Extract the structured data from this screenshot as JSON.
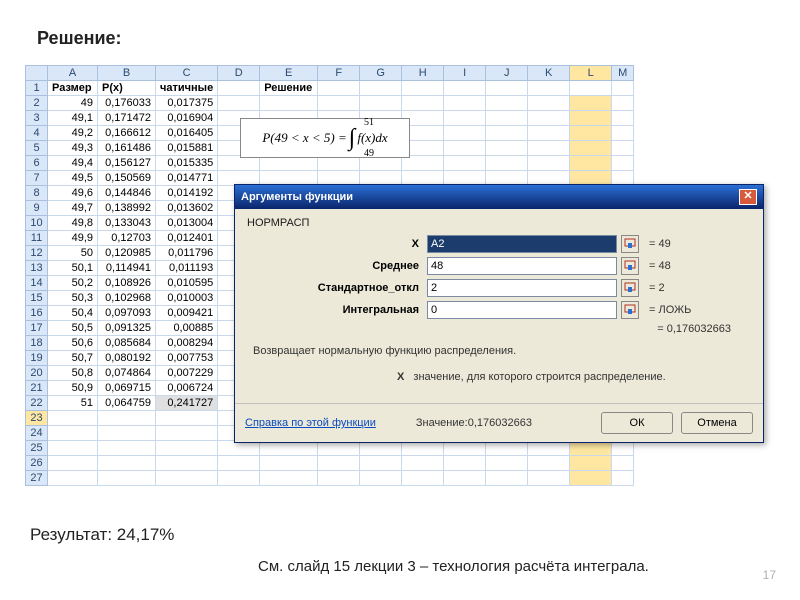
{
  "page": {
    "title": "Решение:",
    "result": "Результат: 24,17%",
    "footnote": "См. слайд 15 лекции 3 – технология расчёта интеграла.",
    "pagenum": "17"
  },
  "formula": {
    "text": "P(49 < x < 5) =",
    "upper": "51",
    "lower": "49",
    "integrand": "f(x)dx"
  },
  "columns": [
    "A",
    "B",
    "C",
    "D",
    "E",
    "F",
    "G",
    "H",
    "I",
    "J",
    "K",
    "L",
    "M"
  ],
  "headers": {
    "A": "Размер",
    "B": "P(x)",
    "C": "чатичные",
    "E": "Решение"
  },
  "rows": [
    {
      "n": "1"
    },
    {
      "n": "2",
      "a": "49",
      "b": "0,176033",
      "c": "0,017375"
    },
    {
      "n": "3",
      "a": "49,1",
      "b": "0,171472",
      "c": "0,016904"
    },
    {
      "n": "4",
      "a": "49,2",
      "b": "0,166612",
      "c": "0,016405"
    },
    {
      "n": "5",
      "a": "49,3",
      "b": "0,161486",
      "c": "0,015881"
    },
    {
      "n": "6",
      "a": "49,4",
      "b": "0,156127",
      "c": "0,015335"
    },
    {
      "n": "7",
      "a": "49,5",
      "b": "0,150569",
      "c": "0,014771"
    },
    {
      "n": "8",
      "a": "49,6",
      "b": "0,144846",
      "c": "0,014192"
    },
    {
      "n": "9",
      "a": "49,7",
      "b": "0,138992",
      "c": "0,013602"
    },
    {
      "n": "10",
      "a": "49,8",
      "b": "0,133043",
      "c": "0,013004"
    },
    {
      "n": "11",
      "a": "49,9",
      "b": "0,12703",
      "c": "0,012401"
    },
    {
      "n": "12",
      "a": "50",
      "b": "0,120985",
      "c": "0,011796"
    },
    {
      "n": "13",
      "a": "50,1",
      "b": "0,114941",
      "c": "0,011193"
    },
    {
      "n": "14",
      "a": "50,2",
      "b": "0,108926",
      "c": "0,010595"
    },
    {
      "n": "15",
      "a": "50,3",
      "b": "0,102968",
      "c": "0,010003"
    },
    {
      "n": "16",
      "a": "50,4",
      "b": "0,097093",
      "c": "0,009421"
    },
    {
      "n": "17",
      "a": "50,5",
      "b": "0,091325",
      "c": "0,00885"
    },
    {
      "n": "18",
      "a": "50,6",
      "b": "0,085684",
      "c": "0,008294"
    },
    {
      "n": "19",
      "a": "50,7",
      "b": "0,080192",
      "c": "0,007753"
    },
    {
      "n": "20",
      "a": "50,8",
      "b": "0,074864",
      "c": "0,007229"
    },
    {
      "n": "21",
      "a": "50,9",
      "b": "0,069715",
      "c": "0,006724"
    },
    {
      "n": "22",
      "a": "51",
      "b": "0,064759",
      "c": "0,241727"
    },
    {
      "n": "23"
    },
    {
      "n": "24"
    },
    {
      "n": "25"
    },
    {
      "n": "26"
    },
    {
      "n": "27"
    }
  ],
  "dialog": {
    "title": "Аргументы функции",
    "fn": "НОРМРАСП",
    "args": [
      {
        "label": "X",
        "value": "A2",
        "eq": "= 49",
        "dark": true
      },
      {
        "label": "Среднее",
        "value": "48",
        "eq": "= 48"
      },
      {
        "label": "Стандартное_откл",
        "value": "2",
        "eq": "= 2"
      },
      {
        "label": "Интегральная",
        "value": "0",
        "eq": "= ЛОЖЬ"
      }
    ],
    "result_eq": "= 0,176032663",
    "desc": "Возвращает нормальную функцию распределения.",
    "hint_label": "X",
    "hint_text": "значение, для которого строится распределение.",
    "help": "Справка по этой функции",
    "value_label": "Значение:",
    "value": "0,176032663",
    "ok": "ОК",
    "cancel": "Отмена"
  }
}
